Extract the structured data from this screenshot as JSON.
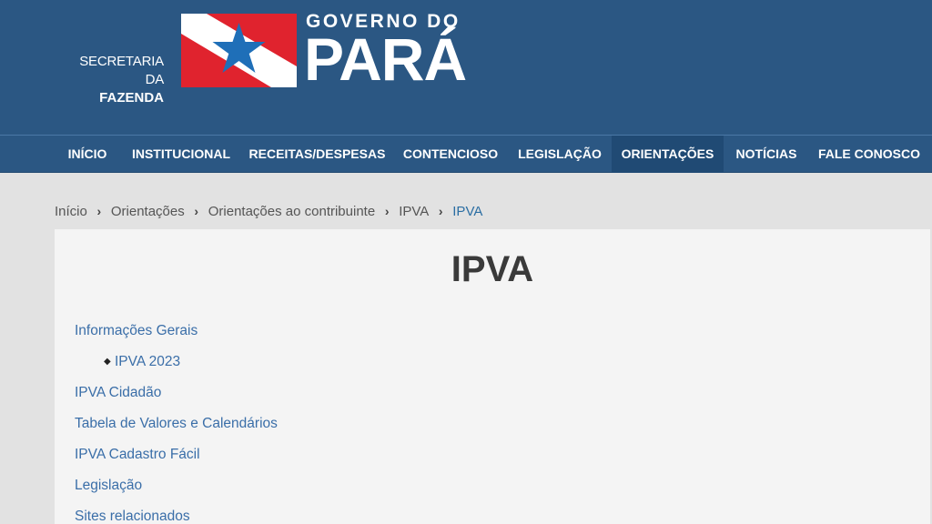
{
  "header": {
    "secretaria_line1": "SECRETARIA DA",
    "secretaria_line2": "FAZENDA",
    "governo_do": "GOVERNO DO",
    "para": "PARÁ",
    "colors": {
      "header_bg": "#2b5783",
      "flag_red": "#e0232e",
      "flag_blue": "#1f6fb8"
    }
  },
  "nav": {
    "items": [
      {
        "label": "INÍCIO"
      },
      {
        "label": "INSTITUCIONAL"
      },
      {
        "label": "RECEITAS/DESPESAS"
      },
      {
        "label": "CONTENCIOSO"
      },
      {
        "label": "LEGISLAÇÃO"
      },
      {
        "label": "ORIENTAÇÕES",
        "active": true
      },
      {
        "label": "NOTÍCIAS"
      },
      {
        "label": "FALE CONOSCO"
      }
    ]
  },
  "breadcrumb": {
    "items": [
      "Início",
      "Orientações",
      "Orientações ao contribuinte",
      "IPVA",
      "IPVA"
    ],
    "separator": "›"
  },
  "main": {
    "title": "IPVA",
    "links": [
      {
        "label": "Informações Gerais"
      },
      {
        "label": "IPVA 2023",
        "sub": true
      },
      {
        "label": "IPVA Cidadão"
      },
      {
        "label": "Tabela de Valores e Calendários"
      },
      {
        "label": "IPVA Cadastro Fácil"
      },
      {
        "label": "Legislação"
      },
      {
        "label": "Sites relacionados"
      }
    ]
  }
}
